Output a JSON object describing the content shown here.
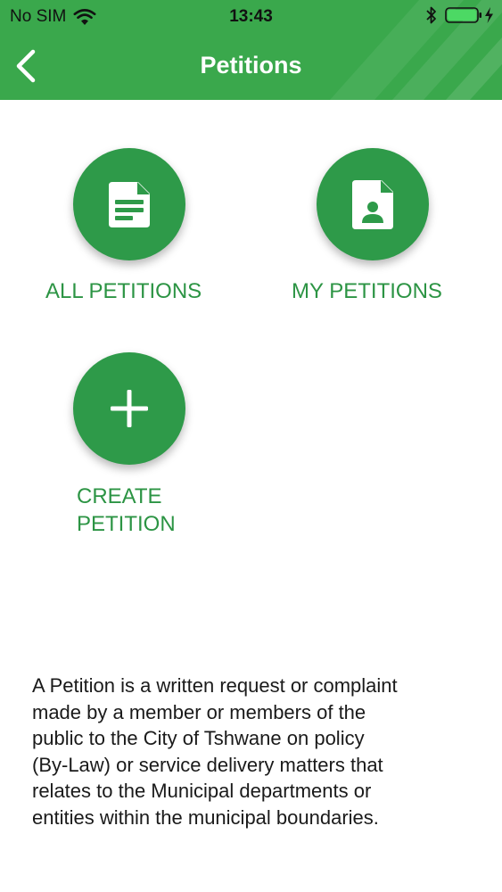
{
  "status_bar": {
    "carrier": "No SIM",
    "time": "13:43",
    "wifi_icon": "wifi-icon",
    "bluetooth_icon": "bluetooth-icon",
    "battery_icon": "battery-charging-icon"
  },
  "header": {
    "title": "Petitions",
    "back_icon": "chevron-left-icon",
    "background_color": "#3aa84c"
  },
  "tiles": [
    {
      "label": "ALL PETITIONS",
      "icon": "document-icon"
    },
    {
      "label": "MY PETITIONS",
      "icon": "user-document-icon"
    },
    {
      "label_line1": "CREATE",
      "label_line2": "PETITION",
      "icon": "plus-icon"
    }
  ],
  "description": {
    "lines": [
      "A Petition is a written request or complaint",
      "made by a member or members of the",
      "public to the City of Tshwane on policy",
      "(By-Law) or service delivery matters that",
      "relates to the Municipal departments or",
      "entities within the municipal boundaries."
    ]
  },
  "colors": {
    "accent": "#2e9a49",
    "label": "#2c9444",
    "text": "#1a1a1a"
  }
}
